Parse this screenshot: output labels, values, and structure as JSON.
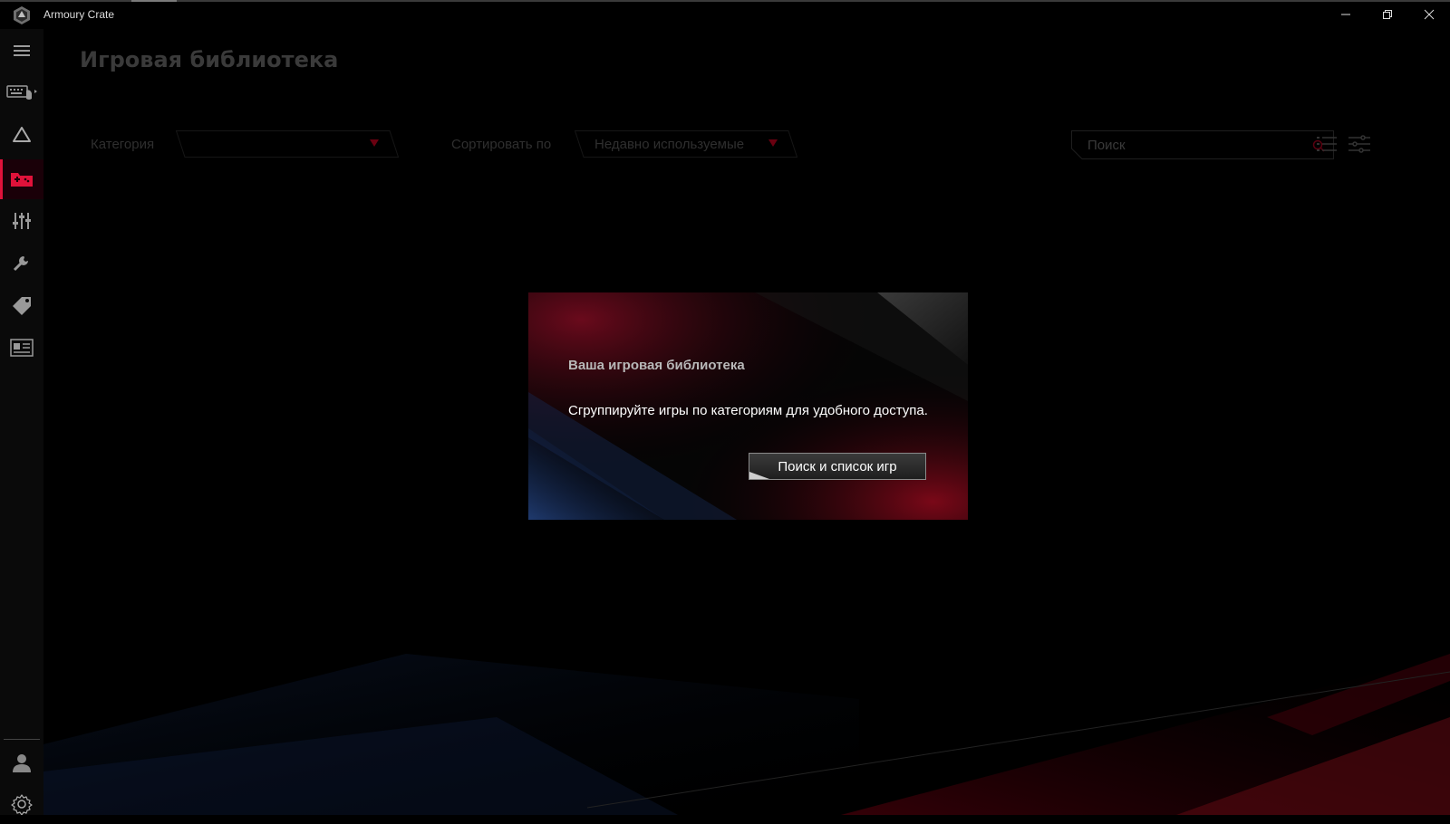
{
  "app": {
    "title": "Armoury Crate"
  },
  "window_controls": {
    "minimize_icon": "minimize-icon",
    "restore_icon": "restore-icon",
    "close_icon": "close-icon"
  },
  "sidebar": {
    "items": [
      {
        "icon": "hamburger-menu-icon",
        "active": false
      },
      {
        "icon": "devices-icon",
        "active": false
      },
      {
        "icon": "aura-sync-icon",
        "active": false
      },
      {
        "icon": "game-library-icon",
        "active": true
      },
      {
        "icon": "scenario-profiles-icon",
        "active": false
      },
      {
        "icon": "tools-icon",
        "active": false
      },
      {
        "icon": "deals-tag-icon",
        "active": false
      },
      {
        "icon": "news-icon",
        "active": false
      }
    ],
    "bottom": [
      {
        "icon": "user-icon"
      },
      {
        "icon": "settings-gear-icon"
      }
    ]
  },
  "page": {
    "title": "Игровая библиотека",
    "category_label": "Категория",
    "category_value": "",
    "sort_label": "Сортировать по",
    "sort_value": "Недавно используемые",
    "search_placeholder": "Поиск"
  },
  "dialog": {
    "title": "Ваша игровая библиотека",
    "text": "Сгруппируйте игры по категориям для удобного доступа.",
    "button_label": "Поиск и список игр"
  },
  "colors": {
    "accent": "#e0123a",
    "background": "#000000",
    "dialog_red": "#8a0a1e",
    "dialog_blue": "#1f3a6e"
  }
}
